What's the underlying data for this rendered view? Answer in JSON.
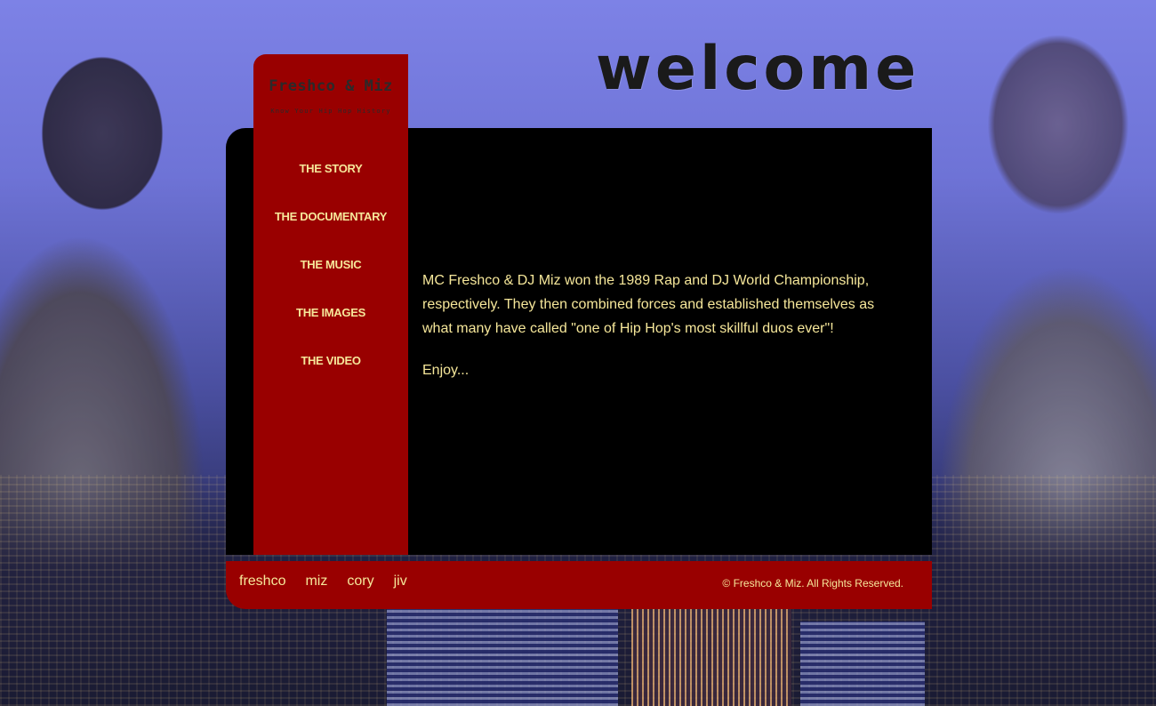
{
  "header": {
    "welcome_text": "welcome"
  },
  "logo": {
    "title": "Freshco & Miz",
    "tagline": "Know Your Hip Hop History"
  },
  "nav": {
    "items": [
      {
        "label": "THE STORY"
      },
      {
        "label": "THE DOCUMENTARY"
      },
      {
        "label": "THE MUSIC"
      },
      {
        "label": "THE IMAGES"
      },
      {
        "label": "THE VIDEO"
      }
    ]
  },
  "content": {
    "paragraph_1": "MC Freshco & DJ Miz won the 1989 Rap and DJ World Championship, respectively. They then combined forces and established themselves as what many have called \"one of Hip Hop's most skillful duos ever\"!",
    "paragraph_2": "Enjoy..."
  },
  "footer": {
    "links": [
      {
        "label": "freshco"
      },
      {
        "label": "miz"
      },
      {
        "label": "cory"
      },
      {
        "label": "jiv"
      }
    ],
    "copyright": "© Freshco & Miz. All Rights Reserved."
  },
  "colors": {
    "accent_red": "#990000",
    "text_yellow": "#f6e79a",
    "panel_black": "#000000",
    "sky_blue": "#7d82e6"
  }
}
